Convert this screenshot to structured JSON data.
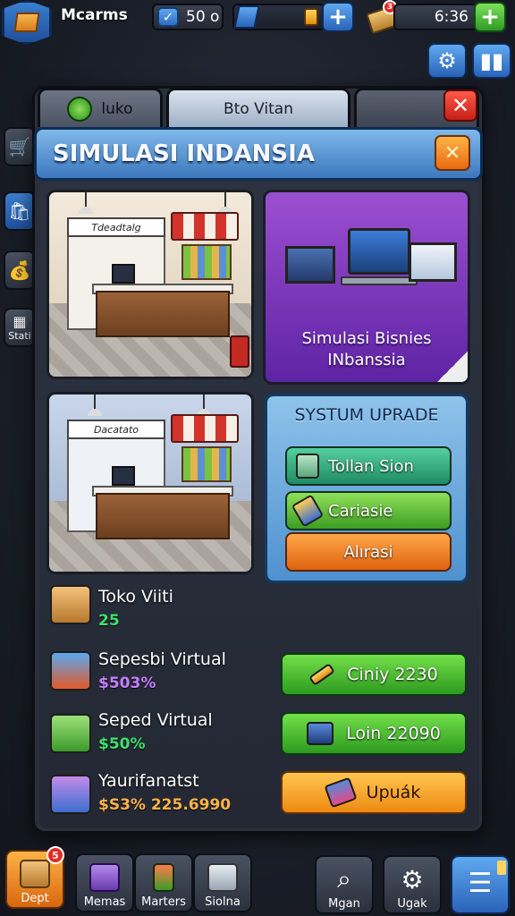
{
  "hud": {
    "player_name": "Mcarms",
    "energy_value": "50 o",
    "timer_value": "6:36",
    "notification_count": "3"
  },
  "window": {
    "tabs": [
      "luko",
      "Bto Vitan"
    ],
    "title": "SIMULASI INDANSIA"
  },
  "side": {
    "stats_label": "Stati"
  },
  "promo": {
    "line1": "Simulasi Bisnies",
    "line2": "INbanssia"
  },
  "shop_signs": [
    "Tdeadtalg",
    "Dacatato"
  ],
  "upgrade": {
    "title": "SYSTUM UPRADE",
    "buttons": [
      "Tollan Sion",
      "Cariasie",
      "Alırasi"
    ]
  },
  "list": [
    {
      "name": "Toko Viiti",
      "value": "25",
      "value_color": "#3ee06a"
    },
    {
      "name": "Sepesbi Virtual",
      "value": "$503%",
      "value_color": "#c77dff",
      "action": "Ciniy 2230"
    },
    {
      "name": "Seped Virtual",
      "value": "$50%",
      "value_color": "#3ee06a",
      "action": "Loin 22090"
    },
    {
      "name": "Yaurifanatst",
      "value": "$S3% 225.6990",
      "value_color": "#ffb347",
      "action": "Upuák"
    }
  ],
  "bottom_nav": [
    {
      "label": "Dept",
      "badge": "5"
    },
    {
      "label": "Memas"
    },
    {
      "label": "Marters"
    },
    {
      "label": "Siolna"
    },
    {
      "label": "Mgan"
    },
    {
      "label": "Ugak"
    }
  ],
  "colors": {
    "accent_blue": "#3c78bd",
    "confirm_green": "#2d9a1f",
    "close_red": "#c61f17",
    "promo_purple": "#5e23a4"
  }
}
